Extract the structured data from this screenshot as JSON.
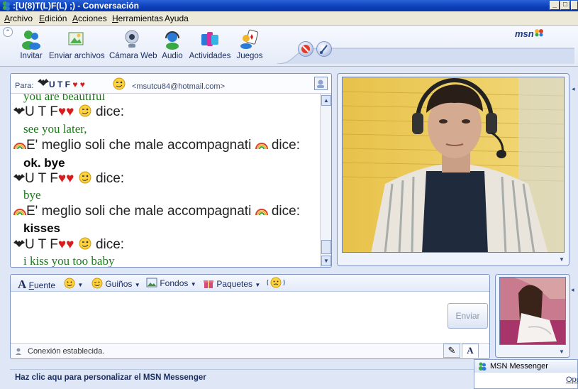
{
  "window": {
    "title": ":[U(8)T(L)F(L)  ;) - Conversación",
    "minimize": "_",
    "maximize": "□"
  },
  "menu": {
    "archivo": "rchivo",
    "archivo_key": "A",
    "edicion": "dición",
    "edicion_key": "E",
    "acciones": "cciones",
    "acciones_key": "A",
    "herramientas": "erramientas",
    "herramientas_key": "H",
    "ayuda": "Ayuda"
  },
  "toolbar": {
    "invitar": "Invitar",
    "enviar_archivos": "Enviar archivos",
    "camara_web": "Cámara Web",
    "audio": "Audio",
    "actividades": "Actividades",
    "juegos": "Juegos",
    "logo": "msn"
  },
  "conversation": {
    "to_label": "Para:",
    "to_name": "U T F",
    "to_email": "<msutcu84@hotmail.com>",
    "messages": [
      {
        "type": "text-green",
        "text": "you are beautiful"
      },
      {
        "type": "sender",
        "name": "U T F",
        "suffix": "dice:"
      },
      {
        "type": "text-green",
        "text": "see you later,"
      },
      {
        "type": "sender",
        "name": "E' meglio soli che male accompagnati",
        "suffix": "dice:"
      },
      {
        "type": "text-bold",
        "text": "ok. bye"
      },
      {
        "type": "sender",
        "name": "U T F",
        "suffix": "dice:"
      },
      {
        "type": "text-green",
        "text": "bye"
      },
      {
        "type": "sender",
        "name": "E' meglio soli che male accompagnati",
        "suffix": "dice:"
      },
      {
        "type": "text-bold",
        "text": "kisses"
      },
      {
        "type": "sender",
        "name": "U T F",
        "suffix": "dice:"
      },
      {
        "type": "text-green",
        "text": "i kiss you too baby"
      }
    ]
  },
  "compose": {
    "fuente": "uente",
    "fuente_key": "F",
    "guinos": "Guiños",
    "fondos": "Fondos",
    "paquetes": "Paquetes",
    "send_label": "Enviar",
    "status": "Conexión establecida."
  },
  "banner": {
    "text": "Haz clic aqu para personalizar el MSN Messenger"
  },
  "popup": {
    "title": "MSN Messenger",
    "link": "Opc"
  },
  "colors": {
    "accent": "#0b3fb8",
    "chat_green": "#1a7a1a",
    "heart_red": "#d81c1c"
  }
}
